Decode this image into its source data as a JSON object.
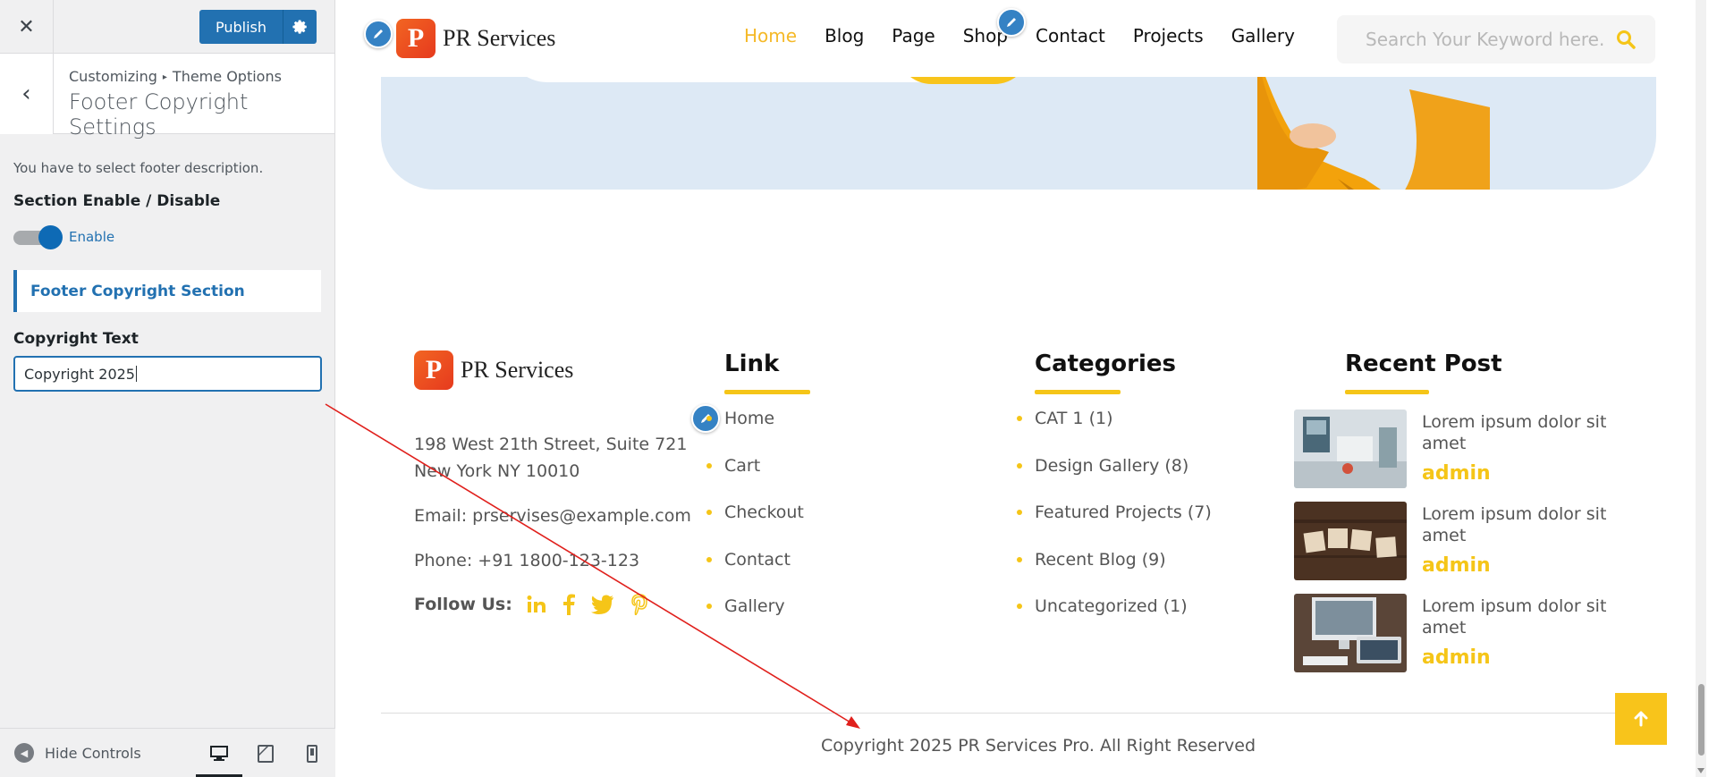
{
  "customizer": {
    "publish_label": "Publish",
    "breadcrumb_root": "Customizing",
    "breadcrumb_sep": "▸",
    "breadcrumb_parent": "Theme Options",
    "section_title": "Footer Copyright Settings",
    "description": "You have to select footer description.",
    "enable_label": "Section Enable / Disable",
    "toggle_state": "Enable",
    "subsection_label": "Footer Copyright Section",
    "copyright_label": "Copyright Text",
    "copyright_value": "Copyright 2025",
    "hide_controls": "Hide Controls",
    "accent_color": "#2271b1"
  },
  "site": {
    "brand_name": "PR Services",
    "logo_letter": "P",
    "nav": [
      {
        "label": "Home",
        "active": true
      },
      {
        "label": "Blog"
      },
      {
        "label": "Page"
      },
      {
        "label": "Shop"
      },
      {
        "label": "Contact"
      },
      {
        "label": "Projects"
      },
      {
        "label": "Gallery"
      }
    ],
    "search_placeholder": "Search Your Keyword here.",
    "accent_color": "#f5c518"
  },
  "footer": {
    "address_line1": "198 West 21th Street, Suite 721",
    "address_line2": "New York NY 10010",
    "email": "Email: prservises@example.com",
    "phone": "Phone: +91 1800-123-123",
    "follow_label": "Follow Us:",
    "link_title": "Link",
    "links": [
      "Home",
      "Cart",
      "Checkout",
      "Contact",
      "Gallery"
    ],
    "categories_title": "Categories",
    "categories": [
      "CAT 1 (1)",
      "Design Gallery (8)",
      "Featured Projects (7)",
      "Recent Blog (9)",
      "Uncategorized (1)"
    ],
    "recent_title": "Recent Post",
    "posts": [
      {
        "title": "Lorem ipsum dolor sit amet",
        "author": "admin"
      },
      {
        "title": "Lorem ipsum dolor sit amet",
        "author": "admin"
      },
      {
        "title": "Lorem ipsum dolor sit amet",
        "author": "admin"
      }
    ],
    "copyright": "Copyright 2025 PR Services Pro. All Right Reserved"
  }
}
